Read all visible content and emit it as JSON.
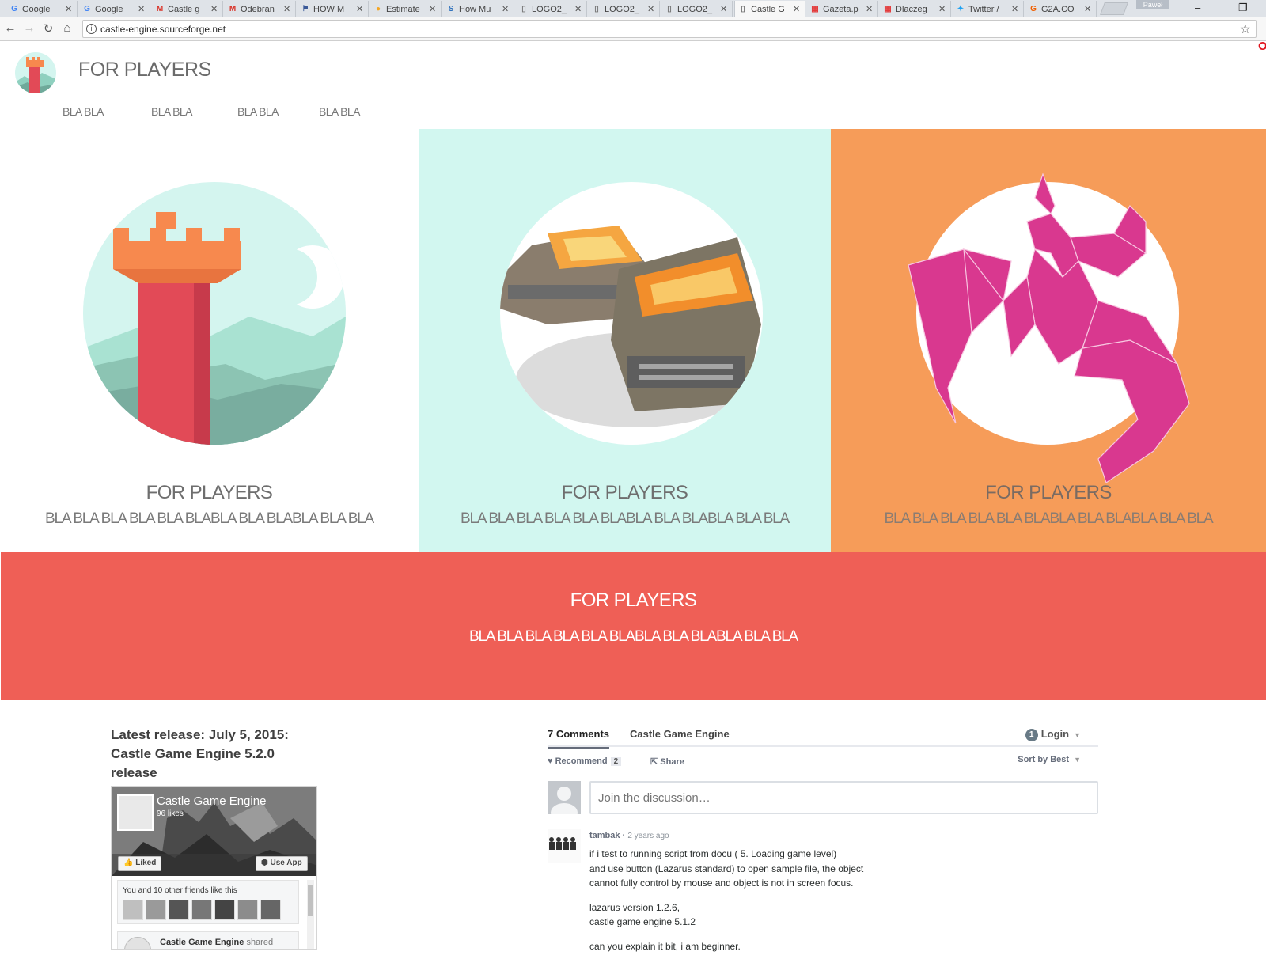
{
  "browser": {
    "tabs": [
      {
        "title": "Google",
        "icon": "google-g-icon",
        "icon_color": "#4285f4",
        "glyph": "G"
      },
      {
        "title": "Google",
        "icon": "google-g-icon",
        "icon_color": "#4285f4",
        "glyph": "G"
      },
      {
        "title": "Castle g",
        "icon": "gmail-icon",
        "icon_color": "#d93025",
        "glyph": "M"
      },
      {
        "title": "Odebran",
        "icon": "gmail-icon",
        "icon_color": "#d93025",
        "glyph": "M"
      },
      {
        "title": "HOW M",
        "icon": "flag-icon",
        "icon_color": "#3b5998",
        "glyph": "⚑"
      },
      {
        "title": "Estimate",
        "icon": "circle-icon",
        "icon_color": "#f5a623",
        "glyph": "●"
      },
      {
        "title": "How Mu",
        "icon": "sa-icon",
        "icon_color": "#2a6ebb",
        "glyph": "S"
      },
      {
        "title": "LOGO2_",
        "icon": "page-icon",
        "icon_color": "#777777",
        "glyph": "▯"
      },
      {
        "title": "LOGO2_",
        "icon": "page-icon",
        "icon_color": "#777777",
        "glyph": "▯"
      },
      {
        "title": "LOGO2_",
        "icon": "page-icon",
        "icon_color": "#777777",
        "glyph": "▯"
      },
      {
        "title": "Castle G",
        "icon": "page-icon",
        "icon_color": "#777777",
        "glyph": "▯",
        "active": true
      },
      {
        "title": "Gazeta.p",
        "icon": "grid-icon",
        "icon_color": "#e33b3b",
        "glyph": "▦"
      },
      {
        "title": "Dlaczeg",
        "icon": "grid-icon",
        "icon_color": "#e33b3b",
        "glyph": "▦"
      },
      {
        "title": "Twitter /",
        "icon": "twitter-icon",
        "icon_color": "#1da1f2",
        "glyph": "✦"
      },
      {
        "title": "G2A.CO",
        "icon": "g2a-icon",
        "icon_color": "#f05f00",
        "glyph": "G"
      }
    ],
    "profile_name": "Paweł",
    "url": "castle-engine.sourceforge.net"
  },
  "site": {
    "title": "FOR PLAYERS",
    "nav": [
      "BLA BLA",
      "BLA BLA",
      "BLA BLA",
      "BLA BLA"
    ]
  },
  "panels": [
    {
      "heading": "FOR PLAYERS",
      "text": "BLA BLA BLA BLA BLA BLABLA BLA BLABLA BLA BLA",
      "bg": "#ffffff",
      "heading_color": "#6e6e6e",
      "text_color": "#7a7a7a",
      "illustration": "castle-tower"
    },
    {
      "heading": "FOR PLAYERS",
      "text": "BLA BLA BLA BLA BLA BLABLA BLA BLABLA BLA BLA",
      "bg": "#d2f7f0",
      "heading_color": "#6e6e6e",
      "text_color": "#7a7a7a",
      "illustration": "wrecked-cars"
    },
    {
      "heading": "FOR PLAYERS",
      "text": "BLA BLA BLA BLA BLA BLABLA BLA BLABLA BLA BLA",
      "bg": "#f69c59",
      "heading_color": "#7a6b62",
      "text_color": "#8a7c72",
      "illustration": "pink-low-poly-creature"
    }
  ],
  "band": {
    "heading": "FOR PLAYERS",
    "text": "BLA BLA BLA BLA BLA BLABLA BLA BLABLA BLA BLA",
    "bg": "#ef5f56"
  },
  "release": {
    "text": "Latest release: July 5, 2015: Castle Game Engine 5.2.0 release"
  },
  "facebook": {
    "page_name": "Castle Game Engine",
    "likes": "96 likes",
    "liked_label": "Liked",
    "use_app_label": "Use App",
    "friends_text": "You and 10 other friends like this",
    "post_author": "Castle Game Engine",
    "post_action": "shared"
  },
  "comments": {
    "count_label": "7 Comments",
    "site_label": "Castle Game Engine",
    "login_label": "Login",
    "login_badge": "1",
    "recommend_label": "Recommend",
    "recommend_count": "2",
    "share_label": "Share",
    "sort_label": "Sort by Best",
    "input_placeholder": "Join the discussion…",
    "first": {
      "author": "tambak",
      "time": "2 years ago",
      "paragraphs": [
        [
          "if i test to running script from docu ( 5. Loading game level)",
          "and use button (Lazarus standard) to open sample file, the object",
          "cannot fully control by mouse and object is not in screen focus."
        ],
        [
          "lazarus version 1.2.6,",
          "castle game engine 5.1.2"
        ],
        [
          "can you explain it bit, i am beginner."
        ]
      ]
    }
  },
  "colors": {
    "accent_red": "#ef5f56",
    "mint": "#d2f7f0",
    "orange": "#f69c59",
    "tower_red": "#e24a57",
    "tower_orange": "#f7894e",
    "creature_pink": "#d9388f"
  }
}
